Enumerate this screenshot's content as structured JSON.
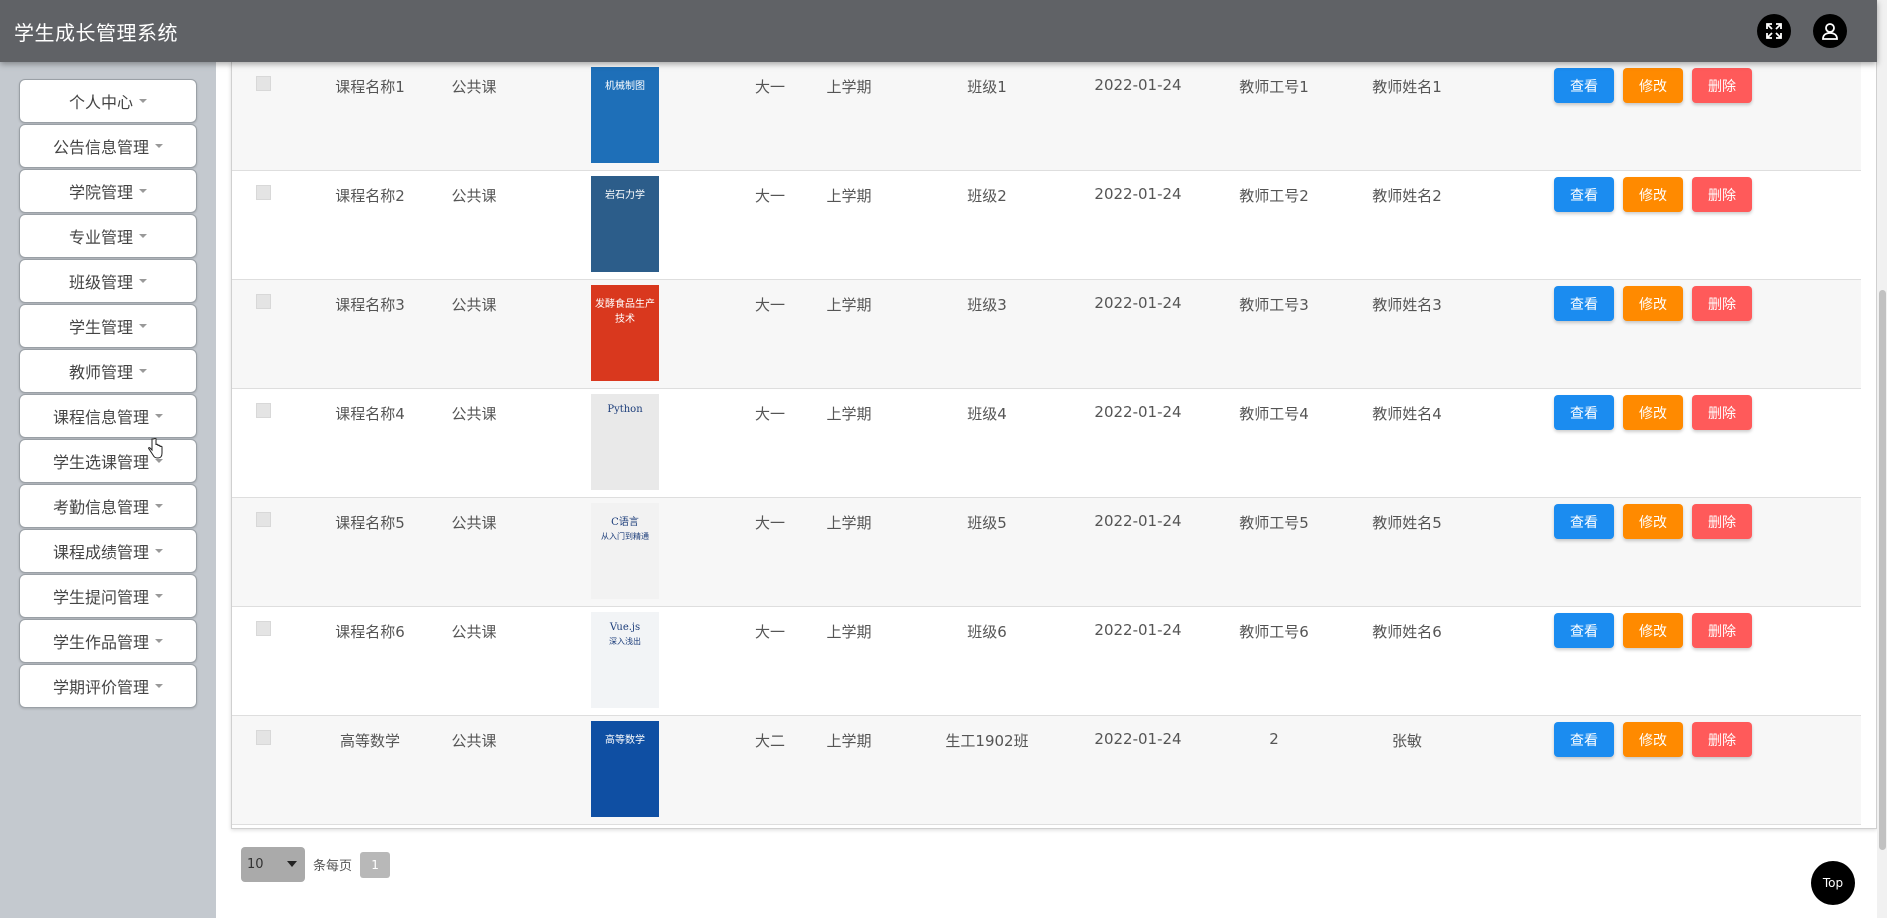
{
  "app": {
    "title": "学生成长管理系统"
  },
  "topbar": {
    "icons": [
      "fullscreen-icon",
      "user-icon"
    ]
  },
  "sidebar": {
    "items": [
      {
        "label": "个人中心"
      },
      {
        "label": "公告信息管理"
      },
      {
        "label": "学院管理"
      },
      {
        "label": "专业管理"
      },
      {
        "label": "班级管理"
      },
      {
        "label": "学生管理"
      },
      {
        "label": "教师管理"
      },
      {
        "label": "课程信息管理"
      },
      {
        "label": "学生选课管理"
      },
      {
        "label": "考勤信息管理"
      },
      {
        "label": "课程成绩管理"
      },
      {
        "label": "学生提问管理"
      },
      {
        "label": "学生作品管理"
      },
      {
        "label": "学期评价管理"
      }
    ]
  },
  "actions": {
    "view": "查看",
    "edit": "修改",
    "delete": "删除"
  },
  "rows": [
    {
      "course": "课程名称1",
      "type": "公共课",
      "cover_title": "机械制图",
      "cover_sub": "",
      "cover_color": "#1e6fb8",
      "grade": "大一",
      "term": "上学期",
      "class": "班级1",
      "date": "2022-01-24",
      "teacher_no": "教师工号1",
      "teacher_name": "教师姓名1"
    },
    {
      "course": "课程名称2",
      "type": "公共课",
      "cover_title": "岩石力学",
      "cover_sub": "",
      "cover_color": "#2c5d8a",
      "grade": "大一",
      "term": "上学期",
      "class": "班级2",
      "date": "2022-01-24",
      "teacher_no": "教师工号2",
      "teacher_name": "教师姓名2"
    },
    {
      "course": "课程名称3",
      "type": "公共课",
      "cover_title": "发酵食品生产技术",
      "cover_sub": "",
      "cover_color": "#d9381e",
      "grade": "大一",
      "term": "上学期",
      "class": "班级3",
      "date": "2022-01-24",
      "teacher_no": "教师工号3",
      "teacher_name": "教师姓名3"
    },
    {
      "course": "课程名称4",
      "type": "公共课",
      "cover_title": "Python",
      "cover_sub": "",
      "cover_color": "#e9e9e9",
      "grade": "大一",
      "term": "上学期",
      "class": "班级4",
      "date": "2022-01-24",
      "teacher_no": "教师工号4",
      "teacher_name": "教师姓名4"
    },
    {
      "course": "课程名称5",
      "type": "公共课",
      "cover_title": "C语言",
      "cover_sub": "从入门到精通",
      "cover_color": "#f2f2f2",
      "grade": "大一",
      "term": "上学期",
      "class": "班级5",
      "date": "2022-01-24",
      "teacher_no": "教师工号5",
      "teacher_name": "教师姓名5"
    },
    {
      "course": "课程名称6",
      "type": "公共课",
      "cover_title": "Vue.js",
      "cover_sub": "深入浅出",
      "cover_color": "#f2f4f6",
      "grade": "大一",
      "term": "上学期",
      "class": "班级6",
      "date": "2022-01-24",
      "teacher_no": "教师工号6",
      "teacher_name": "教师姓名6"
    },
    {
      "course": "高等数学",
      "type": "公共课",
      "cover_title": "高等数学",
      "cover_sub": "",
      "cover_color": "#0f4fa3",
      "grade": "大二",
      "term": "上学期",
      "class": "生工1902班",
      "date": "2022-01-24",
      "teacher_no": "2",
      "teacher_name": "张敏"
    }
  ],
  "pagination": {
    "page_size": "10",
    "per_page_label": "条每页",
    "current_page": "1"
  },
  "top_button": {
    "label": "Top"
  }
}
